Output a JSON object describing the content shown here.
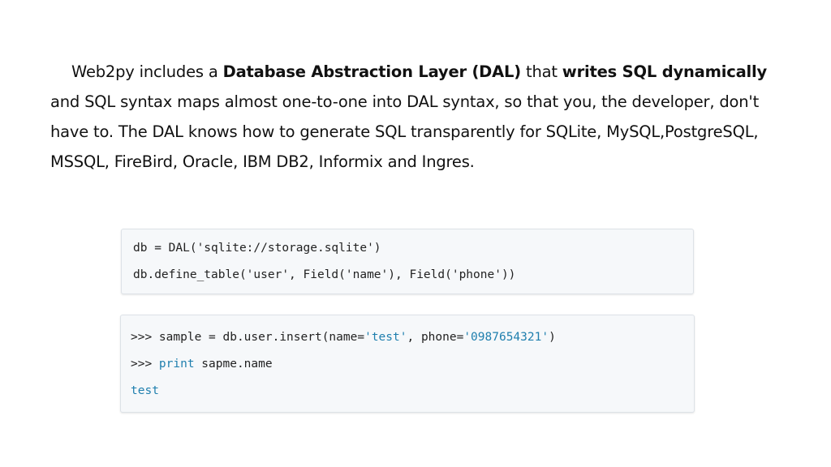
{
  "paragraph": {
    "s1": "Web2py includes a ",
    "b1": "Database Abstraction Layer (DAL)",
    "s2": " that ",
    "b2": "writes SQL dynamically",
    "s3": " and SQL syntax maps almost one-to-one into DAL syntax, so that you, the developer, don't have to. The DAL knows how to generate SQL transparently for SQLite, MySQL,PostgreSQL, MSSQL, FireBird, Oracle, IBM DB2, Informix and Ingres."
  },
  "code1": {
    "line1": "db = DAL('sqlite://storage.sqlite')",
    "line2": "db.define_table('user', Field('name'), Field('phone'))"
  },
  "code2": {
    "l1_a": ">>> sample = db.user.insert(name=",
    "l1_b": "'test'",
    "l1_c": ", phone=",
    "l1_d": "'0987654321'",
    "l1_e": ")",
    "l2_a": ">>> ",
    "l2_b": "print",
    "l2_c": " sapme.name",
    "l3": "test"
  },
  "colors": {
    "string": "#1f7fae",
    "code_bg": "#f6f8fa",
    "border": "#dde2e7"
  }
}
